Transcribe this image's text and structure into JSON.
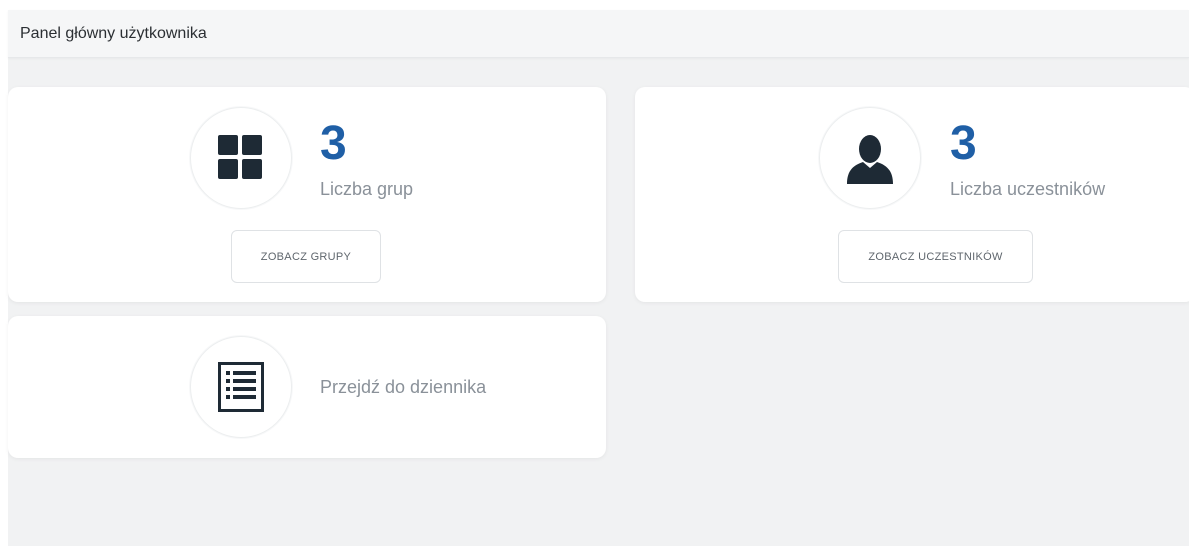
{
  "header": {
    "title": "Panel główny użytkownika"
  },
  "cards": {
    "groups": {
      "icon": "grid-icon",
      "value": "3",
      "label": "Liczba grup",
      "button_label": "ZOBACZ GRUPY"
    },
    "participants": {
      "icon": "user-icon",
      "value": "3",
      "label": "Liczba uczestników",
      "button_label": "ZOBACZ UCZESTNIKÓW"
    },
    "journal": {
      "icon": "list-icon",
      "label": "Przejdź do dziennika"
    }
  },
  "colors": {
    "accent": "#1f5fa6",
    "icon": "#1e2a35",
    "background": "#f1f2f3"
  }
}
